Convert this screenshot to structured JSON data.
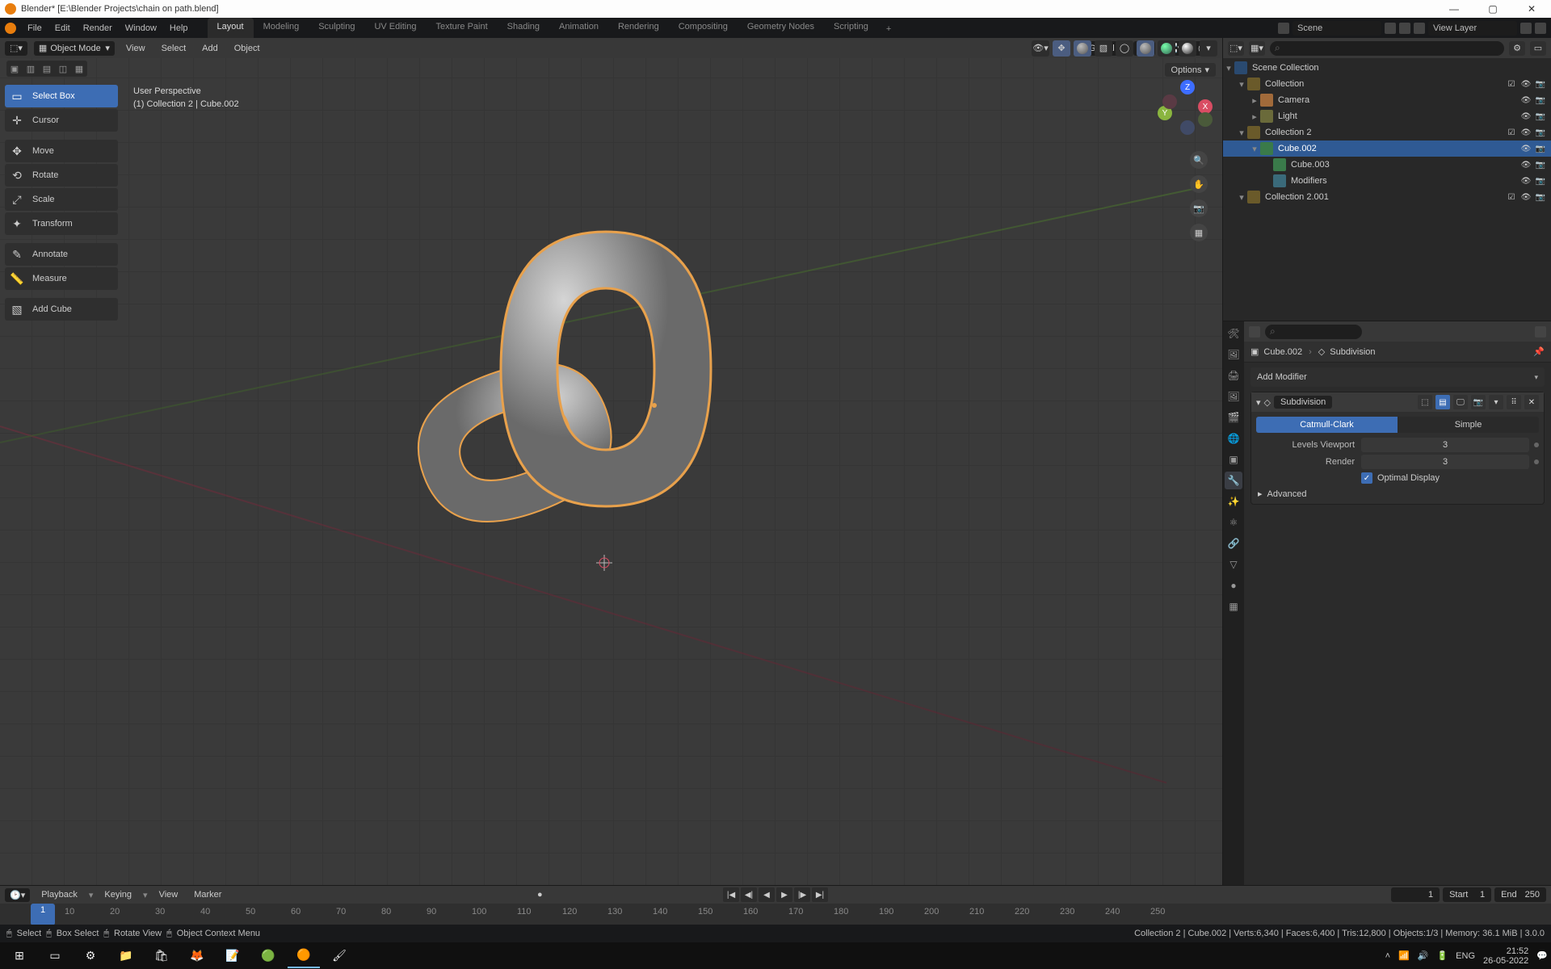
{
  "window": {
    "title": "Blender* [E:\\Blender Projects\\chain on path.blend]"
  },
  "top_menu": {
    "items": [
      "File",
      "Edit",
      "Render",
      "Window",
      "Help"
    ]
  },
  "workspaces": {
    "tabs": [
      "Layout",
      "Modeling",
      "Sculpting",
      "UV Editing",
      "Texture Paint",
      "Shading",
      "Animation",
      "Rendering",
      "Compositing",
      "Geometry Nodes",
      "Scripting"
    ],
    "active": "Layout"
  },
  "top_right": {
    "scene_label": "Scene",
    "viewlayer_label": "View Layer"
  },
  "viewport_header": {
    "mode": "Object Mode",
    "menus": [
      "View",
      "Select",
      "Add",
      "Object"
    ],
    "orientation": "Global",
    "options_label": "Options"
  },
  "viewport_info": {
    "line1": "User Perspective",
    "line2": "(1) Collection 2 | Cube.002"
  },
  "toolbar": {
    "tools": [
      {
        "name": "select-box",
        "label": "Select Box",
        "active": true
      },
      {
        "name": "cursor",
        "label": "Cursor"
      },
      {
        "name": "move",
        "label": "Move"
      },
      {
        "name": "rotate",
        "label": "Rotate"
      },
      {
        "name": "scale",
        "label": "Scale"
      },
      {
        "name": "transform",
        "label": "Transform"
      },
      {
        "name": "annotate",
        "label": "Annotate"
      },
      {
        "name": "measure",
        "label": "Measure"
      },
      {
        "name": "add-cube",
        "label": "Add Cube"
      }
    ]
  },
  "outliner": {
    "root": "Scene Collection",
    "items": [
      {
        "label": "Collection",
        "type": "coll",
        "depth": 1
      },
      {
        "label": "Camera",
        "type": "obj",
        "depth": 2
      },
      {
        "label": "Light",
        "type": "light",
        "depth": 2
      },
      {
        "label": "Collection 2",
        "type": "coll",
        "depth": 1
      },
      {
        "label": "Cube.002",
        "type": "mesh",
        "depth": 2,
        "selected": true
      },
      {
        "label": "Cube.003",
        "type": "mesh",
        "depth": 3
      },
      {
        "label": "Modifiers",
        "type": "mod",
        "depth": 3
      },
      {
        "label": "Collection 2.001",
        "type": "coll",
        "depth": 1
      }
    ]
  },
  "properties": {
    "breadcrumb": {
      "object": "Cube.002",
      "modifier": "Subdivision"
    },
    "add_modifier_label": "Add Modifier",
    "modifier": {
      "name": "Subdivision",
      "mode_a": "Catmull-Clark",
      "mode_b": "Simple",
      "levels_label": "Levels Viewport",
      "levels_value": "3",
      "render_label": "Render",
      "render_value": "3",
      "optimal_label": "Optimal Display",
      "advanced_label": "Advanced"
    }
  },
  "timeline": {
    "menus": [
      "Playback",
      "Keying",
      "View",
      "Marker"
    ],
    "current": "1",
    "start_label": "Start",
    "start_value": "1",
    "end_label": "End",
    "end_value": "250",
    "ticks": [
      "10",
      "20",
      "30",
      "40",
      "50",
      "60",
      "70",
      "80",
      "90",
      "100",
      "110",
      "120",
      "130",
      "140",
      "150",
      "160",
      "170",
      "180",
      "190",
      "200",
      "210",
      "220",
      "230",
      "240",
      "250"
    ]
  },
  "status_bar": {
    "left": [
      {
        "icon": "mouse-left",
        "label": "Select"
      },
      {
        "icon": "mouse-left",
        "label": "Box Select"
      },
      {
        "icon": "mouse-middle",
        "label": "Rotate View"
      },
      {
        "icon": "mouse-right",
        "label": "Object Context Menu"
      }
    ],
    "right": "Collection 2 | Cube.002 | Verts:6,340 | Faces:6,400 | Tris:12,800 | Objects:1/3 | Memory: 36.1 MiB | 3.0.0"
  },
  "taskbar": {
    "time": "21:52",
    "date": "26-05-2022",
    "lang": "ENG"
  }
}
